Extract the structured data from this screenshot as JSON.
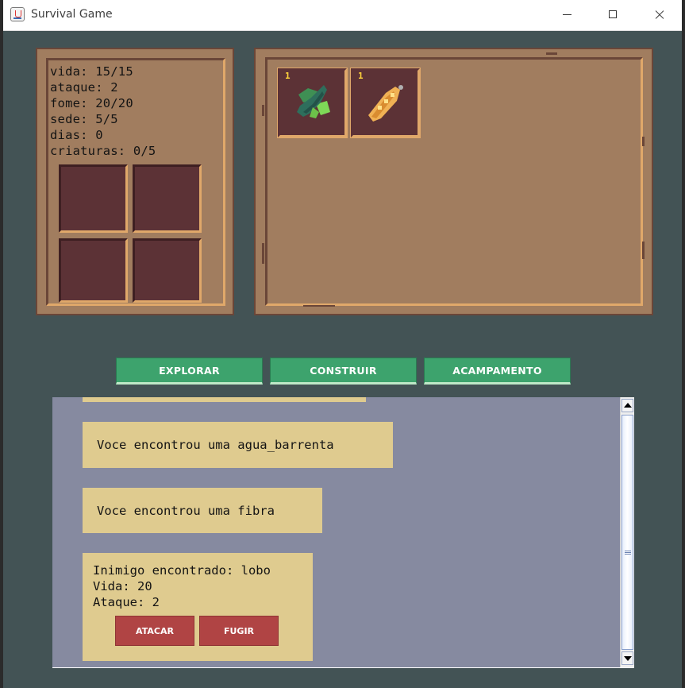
{
  "window": {
    "title": "Survival Game"
  },
  "stats": {
    "lines": [
      "vida: 15/15",
      "ataque: 2",
      "fome: 20/20",
      "sede: 5/5",
      "dias: 0",
      "criaturas: 0/5"
    ]
  },
  "inventory": {
    "items": [
      {
        "icon": "leaf-icon",
        "count": "1"
      },
      {
        "icon": "bread-icon",
        "count": "1"
      }
    ]
  },
  "actions": {
    "explore_label": "EXPLORAR",
    "build_label": "CONSTRUIR",
    "camp_label": "ACAMPAMENTO"
  },
  "log": {
    "messages": [
      "Voce encontrou uma agua_barrenta",
      "Voce encontrou uma fibra"
    ],
    "enemy": {
      "line1": "Inimigo encontrado: lobo",
      "line2": "Vida: 20",
      "line3": "Ataque: 2",
      "attack_label": "ATACAR",
      "flee_label": "FUGIR"
    }
  },
  "colors": {
    "background": "#435355",
    "panel": "#a17d5f",
    "slot": "#5c3236",
    "button_green": "#3da36d",
    "button_red": "#b04444",
    "message_bg": "#dfcb8f",
    "log_bg": "#868aa0"
  }
}
